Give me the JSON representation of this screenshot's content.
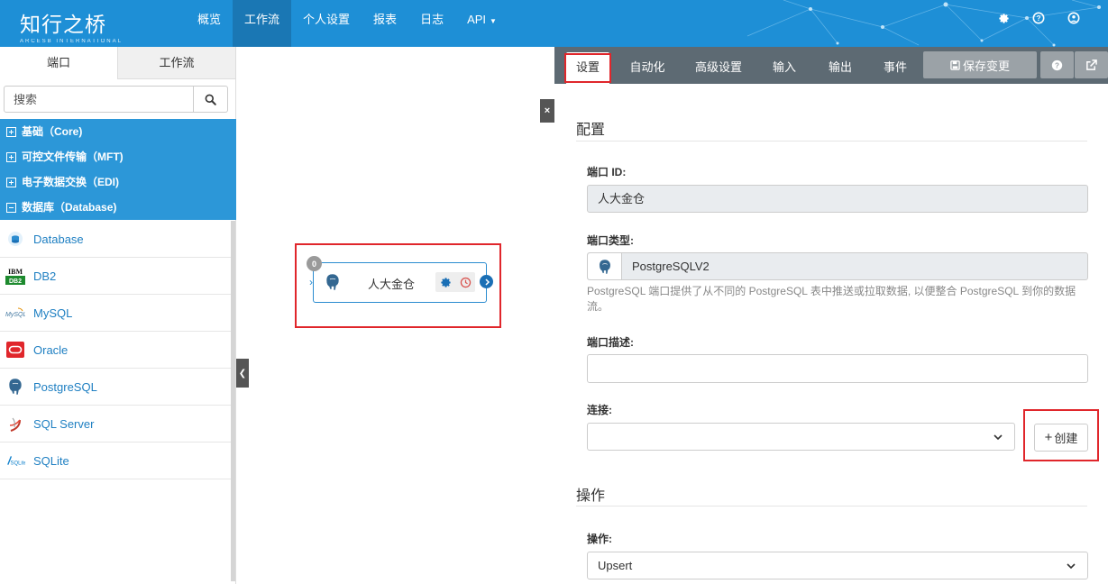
{
  "app": {
    "logo_cn": "知行之桥",
    "logo_en": "ARCESB INTERNATIONAL"
  },
  "nav": {
    "items": [
      {
        "label": "概览"
      },
      {
        "label": "工作流"
      },
      {
        "label": "个人设置"
      },
      {
        "label": "报表"
      },
      {
        "label": "日志"
      },
      {
        "label": "API"
      }
    ],
    "active": "工作流"
  },
  "sidebar": {
    "tabs": [
      {
        "label": "端口"
      },
      {
        "label": "工作流"
      }
    ],
    "search_placeholder": "搜索",
    "groups": [
      {
        "label": "基础（Core)",
        "expanded": false
      },
      {
        "label": "可控文件传输（MFT)",
        "expanded": false
      },
      {
        "label": "电子数据交换（EDI)",
        "expanded": false
      },
      {
        "label": "数据库（Database)",
        "expanded": true
      }
    ],
    "connectors": [
      {
        "label": "Database",
        "icon": "database-icon"
      },
      {
        "label": "DB2",
        "icon": "ibm-db2-icon"
      },
      {
        "label": "MySQL",
        "icon": "mysql-icon"
      },
      {
        "label": "Oracle",
        "icon": "oracle-icon"
      },
      {
        "label": "PostgreSQL",
        "icon": "postgresql-elephant-icon"
      },
      {
        "label": "SQL Server",
        "icon": "sql-server-icon"
      },
      {
        "label": "SQLite",
        "icon": "sqlite-icon"
      }
    ]
  },
  "canvas": {
    "node": {
      "badge": "0",
      "name": "人大金仓",
      "icon": "postgresql-elephant-icon"
    }
  },
  "panel": {
    "tabs": [
      {
        "label": "设置"
      },
      {
        "label": "自动化"
      },
      {
        "label": "高级设置"
      },
      {
        "label": "输入"
      },
      {
        "label": "输出"
      },
      {
        "label": "事件"
      }
    ],
    "save_label": "保存变更",
    "config": {
      "title": "配置",
      "port_id_label": "端口 ID:",
      "port_id_value": "人大金仓",
      "port_type_label": "端口类型:",
      "port_type_value": "PostgreSQLV2",
      "port_type_help": "PostgreSQL 端口提供了从不同的 PostgreSQL 表中推送或拉取数据, 以便整合 PostgreSQL 到你的数据流。",
      "port_desc_label": "端口描述:",
      "port_desc_value": "",
      "connection_label": "连接:",
      "connection_value": "",
      "create_label": "创建"
    },
    "operation": {
      "title": "操作",
      "label": "操作:",
      "value": "Upsert"
    }
  },
  "colors": {
    "brand": "#1e8fd6",
    "group_bg": "#2c97d8",
    "highlight": "#e0262b",
    "panel_tabs": "#5d6a73"
  }
}
